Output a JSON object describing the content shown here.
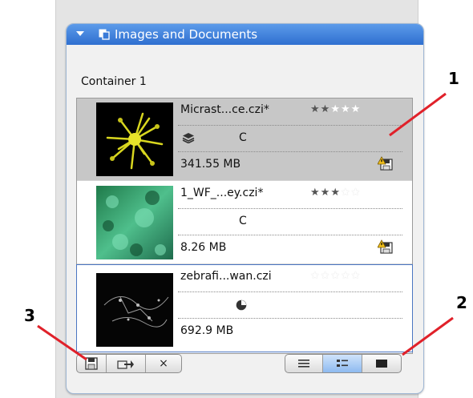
{
  "panel": {
    "title": "Images and Documents",
    "container_label": "Container 1"
  },
  "files": [
    {
      "name": "Micrast...ce.czi*",
      "rating": 2,
      "letter": "C",
      "size": "341.55 MB",
      "selected": true
    },
    {
      "name": "1_WF_...ey.czi*",
      "rating": 3,
      "letter": "C",
      "size": "8.26 MB",
      "selected": false
    },
    {
      "name": "zebrafi...wan.czi",
      "rating": 0,
      "letter": "",
      "size": "692.9 MB",
      "selected": false
    }
  ],
  "toolbar": {
    "close_label": "×"
  },
  "callouts": {
    "one": "1",
    "two": "2",
    "three": "3"
  },
  "colors": {
    "title_bar": "#3a7bd8",
    "callout_line": "#e0212a"
  }
}
